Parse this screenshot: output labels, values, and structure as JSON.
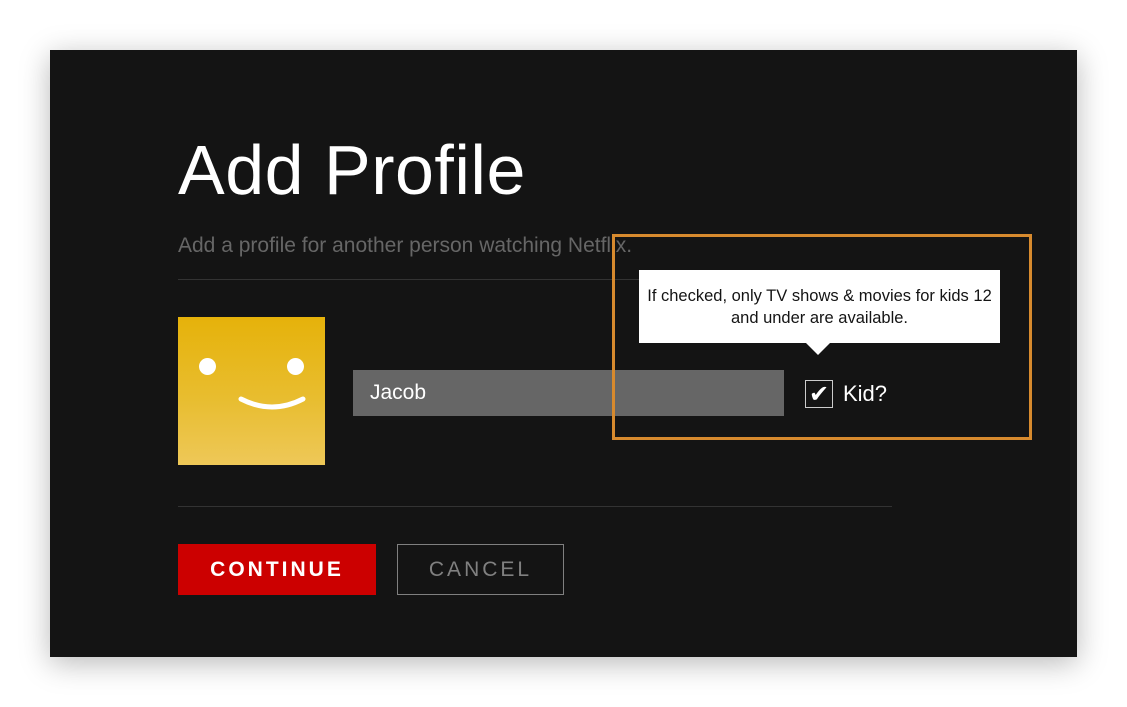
{
  "page": {
    "title": "Add Profile",
    "subtitle": "Add a profile for another person watching Netflix."
  },
  "profile": {
    "name_value": "Jacob",
    "avatar_icon": "smiley-face-icon",
    "avatar_color": "#e6b20a"
  },
  "kid": {
    "label": "Kid?",
    "checked": true,
    "check_glyph": "✔",
    "tooltip": "If checked, only TV shows & movies for kids 12 and under are available."
  },
  "buttons": {
    "continue_label": "CONTINUE",
    "cancel_label": "CANCEL"
  },
  "colors": {
    "background": "#141414",
    "accent": "#cc0000",
    "highlight": "#d78a2e",
    "input_bg": "#666666"
  }
}
